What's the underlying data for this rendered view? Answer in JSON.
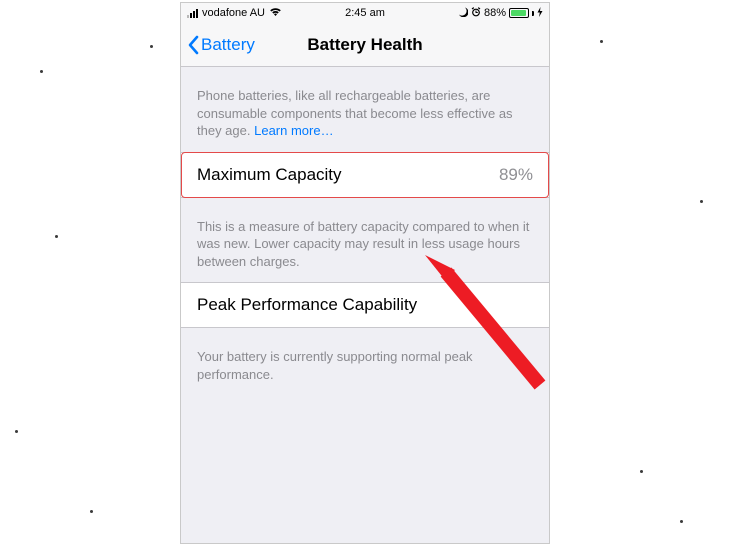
{
  "status_bar": {
    "carrier": "vodafone AU",
    "time": "2:45 am",
    "battery_pct": "88%"
  },
  "nav": {
    "back_label": "Battery",
    "title": "Battery Health"
  },
  "intro": {
    "text": "Phone batteries, like all rechargeable batteries, are consumable components that become less effective as they age. ",
    "learn_more": "Learn more…"
  },
  "capacity": {
    "label": "Maximum Capacity",
    "value": "89%",
    "desc": "This is a measure of battery capacity compared to when it was new. Lower capacity may result in less usage hours between charges."
  },
  "peak": {
    "label": "Peak Performance Capability",
    "desc": "Your battery is currently supporting normal peak performance."
  }
}
